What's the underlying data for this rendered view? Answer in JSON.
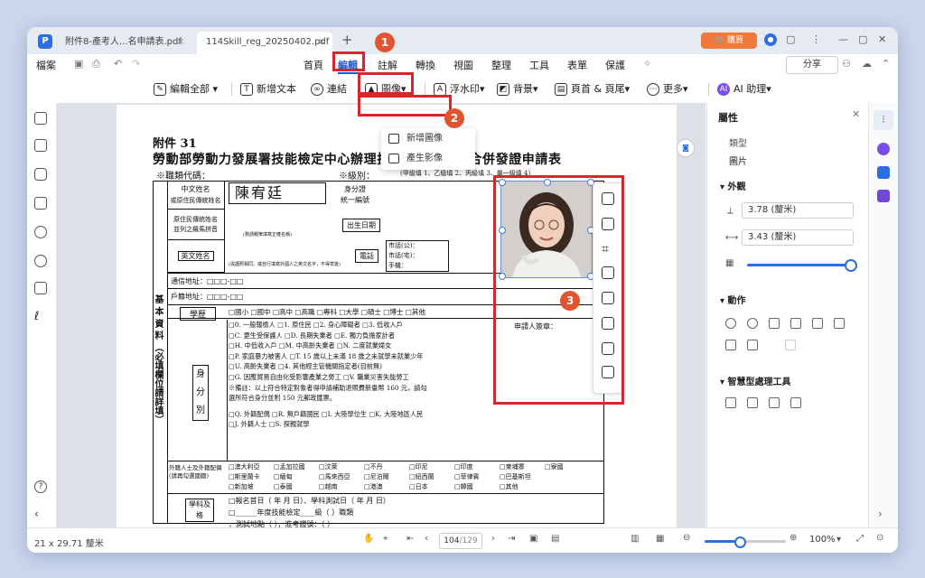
{
  "tabs": [
    {
      "label": "附件8-產考人...名申請表.pdf"
    },
    {
      "label": "114Skill_reg_20250402.pdf *"
    }
  ],
  "titlebar": {
    "buy_label": "購買",
    "new_tab": "+"
  },
  "menu": {
    "file": "檔案",
    "items": [
      "首頁",
      "編輯",
      "註解",
      "轉換",
      "視圖",
      "整理",
      "工具",
      "表單",
      "保護"
    ],
    "share": "分享"
  },
  "toolbar": {
    "edit_all": "編輯全部",
    "add_text": "新增文本",
    "link": "連結",
    "image": "圖像",
    "watermark": "浮水印",
    "background": "背景",
    "header_footer": "頁首 & 頁尾",
    "more": "更多",
    "ai": "AI 助理"
  },
  "dropdown": {
    "items": [
      "新增圖像",
      "產生影像"
    ]
  },
  "badges": [
    "1",
    "2",
    "3"
  ],
  "document": {
    "attachment": "附件 31",
    "title": "勞動部勞動力發展署技能檢定中心辦理技術士技能檢定合併發證申請表",
    "job_code": "※職類代碼：",
    "level": "※級別：",
    "level_note": "(甲級填 1、乙級填 2、丙級填 3、單一級填 4)",
    "chinese_name_label": "中文姓名",
    "chinese_name_sub": "或原住民傳統姓名",
    "name_value": "陳宥廷",
    "id_label": "身分證",
    "id_sub": "統一編號",
    "aboriginal_label": "原住民傳統姓名",
    "aboriginal_sub": "並列之羅馬拼音",
    "birth_label": "出生日期",
    "roman_note": "(務請親筆填寫正確名稱)",
    "english_label": "英文姓名",
    "english_note": "(與護照相同，或自行填寫外國人之英文名字，不得草簽)",
    "phone_label": "電話",
    "phone_lines": [
      "市話(公)：",
      "市話(宅)：",
      "手機："
    ],
    "mail_addr": "通信地址：□□□-□□",
    "reg_addr": "戶籍地址：□□□-□□",
    "section_side": "基 本 資 料 （必填欄位請詳填）",
    "education_label": "學歷",
    "education_options": "□國小 □國中 □高中 □高職 □專科 □大學 □碩士 □博士 □其他",
    "identity_label": "身 分 別",
    "identity_lines": [
      "□0. 一般報檢人    □1. 原住民    □2. 身心障礙者   □3. 低收入戶",
      "□C. 更生受保護人  □D. 長期失業者      □E. 獨力負擔家計者",
      "□H. 中低收入戶    □M. 中高齡失業者    □N. 二度就業婦女",
      "□P. 家庭暴力被害人 □T. 15 歲以上未滿 18 歲之未就學未就業少年",
      "□U. 高齡失業者    □4. 其他經主管機關指定者(目前無)",
      "□G. 因應貿易自由化受影響產業之勞工    □V. 職業災害失能勞工",
      "※備註：以上符合特定對象者得申請補助退照費新臺幣 160 元，請勾",
      "選所符合身分並附 150 元郵政匯票。",
      "□Q. 外籍配偶  □R. 無戶籍國民  □I. 大陸學位生  □K. 大陸地區人民",
      "□J. 外籍人士  □S. 探親就學"
    ],
    "applicant_sign": "申請人簽章：",
    "foreign_label": "外籍人士及外籍配偶(請再勾選國籍)",
    "countries": [
      [
        "□澳大利亞",
        "□孟加拉國",
        "□汶萊",
        "□不丹",
        "□印尼",
        "□印度",
        "□柬埔寨",
        "□寮國"
      ],
      [
        "□斯里蘭卡",
        "□緬甸",
        "□馬來西亞",
        "□尼泊爾",
        "□紐西蘭",
        "□菲律賓",
        "□巴基斯坦",
        ""
      ],
      [
        "□新加坡",
        "□泰國",
        "□越南",
        "□港澳",
        "□日本",
        "□韓國",
        "□其他",
        ""
      ]
    ],
    "exam_label": "學科及格",
    "exam_lines": [
      "□報名首日（    年    月    日）、學科測試日（    年    月    日）",
      "□______年度技能檢定____級（                    ）職類",
      "，測試地點（                    ），准考證號：（              ）"
    ]
  },
  "properties": {
    "title": "屬性",
    "type_label": "類型",
    "type_value": "圖片",
    "appearance": "外觀",
    "height": "3.78 (釐米)",
    "width": "3.43 (釐米)",
    "opacity": 1.0,
    "actions": "動作",
    "smart_tools": "智慧型處理工具"
  },
  "status": {
    "page_size": "21 x 29.71 釐米",
    "page_current": "104",
    "page_total": "/129",
    "zoom": "100%"
  },
  "colors": {
    "accent": "#1d5ad8",
    "highlight": "#d8262a",
    "badge": "#e0552f"
  }
}
